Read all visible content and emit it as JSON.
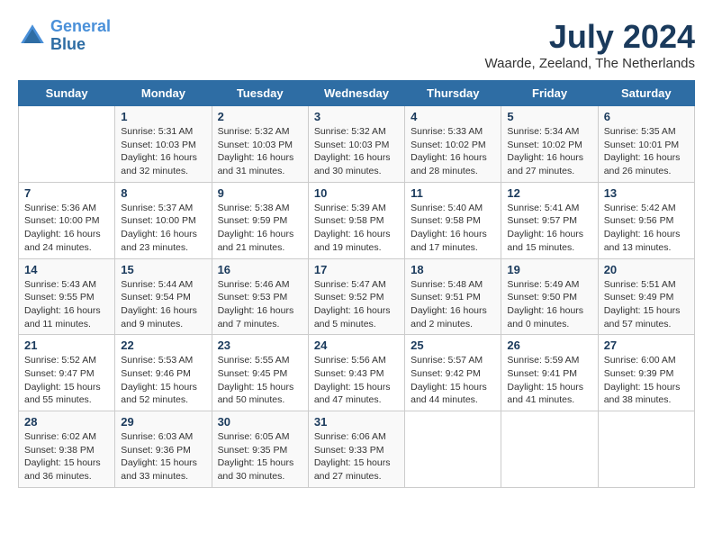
{
  "header": {
    "logo_line1": "General",
    "logo_line2": "Blue",
    "month_year": "July 2024",
    "location": "Waarde, Zeeland, The Netherlands"
  },
  "days_of_week": [
    "Sunday",
    "Monday",
    "Tuesday",
    "Wednesday",
    "Thursday",
    "Friday",
    "Saturday"
  ],
  "weeks": [
    [
      {
        "day": "",
        "info": ""
      },
      {
        "day": "1",
        "info": "Sunrise: 5:31 AM\nSunset: 10:03 PM\nDaylight: 16 hours\nand 32 minutes."
      },
      {
        "day": "2",
        "info": "Sunrise: 5:32 AM\nSunset: 10:03 PM\nDaylight: 16 hours\nand 31 minutes."
      },
      {
        "day": "3",
        "info": "Sunrise: 5:32 AM\nSunset: 10:03 PM\nDaylight: 16 hours\nand 30 minutes."
      },
      {
        "day": "4",
        "info": "Sunrise: 5:33 AM\nSunset: 10:02 PM\nDaylight: 16 hours\nand 28 minutes."
      },
      {
        "day": "5",
        "info": "Sunrise: 5:34 AM\nSunset: 10:02 PM\nDaylight: 16 hours\nand 27 minutes."
      },
      {
        "day": "6",
        "info": "Sunrise: 5:35 AM\nSunset: 10:01 PM\nDaylight: 16 hours\nand 26 minutes."
      }
    ],
    [
      {
        "day": "7",
        "info": "Sunrise: 5:36 AM\nSunset: 10:00 PM\nDaylight: 16 hours\nand 24 minutes."
      },
      {
        "day": "8",
        "info": "Sunrise: 5:37 AM\nSunset: 10:00 PM\nDaylight: 16 hours\nand 23 minutes."
      },
      {
        "day": "9",
        "info": "Sunrise: 5:38 AM\nSunset: 9:59 PM\nDaylight: 16 hours\nand 21 minutes."
      },
      {
        "day": "10",
        "info": "Sunrise: 5:39 AM\nSunset: 9:58 PM\nDaylight: 16 hours\nand 19 minutes."
      },
      {
        "day": "11",
        "info": "Sunrise: 5:40 AM\nSunset: 9:58 PM\nDaylight: 16 hours\nand 17 minutes."
      },
      {
        "day": "12",
        "info": "Sunrise: 5:41 AM\nSunset: 9:57 PM\nDaylight: 16 hours\nand 15 minutes."
      },
      {
        "day": "13",
        "info": "Sunrise: 5:42 AM\nSunset: 9:56 PM\nDaylight: 16 hours\nand 13 minutes."
      }
    ],
    [
      {
        "day": "14",
        "info": "Sunrise: 5:43 AM\nSunset: 9:55 PM\nDaylight: 16 hours\nand 11 minutes."
      },
      {
        "day": "15",
        "info": "Sunrise: 5:44 AM\nSunset: 9:54 PM\nDaylight: 16 hours\nand 9 minutes."
      },
      {
        "day": "16",
        "info": "Sunrise: 5:46 AM\nSunset: 9:53 PM\nDaylight: 16 hours\nand 7 minutes."
      },
      {
        "day": "17",
        "info": "Sunrise: 5:47 AM\nSunset: 9:52 PM\nDaylight: 16 hours\nand 5 minutes."
      },
      {
        "day": "18",
        "info": "Sunrise: 5:48 AM\nSunset: 9:51 PM\nDaylight: 16 hours\nand 2 minutes."
      },
      {
        "day": "19",
        "info": "Sunrise: 5:49 AM\nSunset: 9:50 PM\nDaylight: 16 hours\nand 0 minutes."
      },
      {
        "day": "20",
        "info": "Sunrise: 5:51 AM\nSunset: 9:49 PM\nDaylight: 15 hours\nand 57 minutes."
      }
    ],
    [
      {
        "day": "21",
        "info": "Sunrise: 5:52 AM\nSunset: 9:47 PM\nDaylight: 15 hours\nand 55 minutes."
      },
      {
        "day": "22",
        "info": "Sunrise: 5:53 AM\nSunset: 9:46 PM\nDaylight: 15 hours\nand 52 minutes."
      },
      {
        "day": "23",
        "info": "Sunrise: 5:55 AM\nSunset: 9:45 PM\nDaylight: 15 hours\nand 50 minutes."
      },
      {
        "day": "24",
        "info": "Sunrise: 5:56 AM\nSunset: 9:43 PM\nDaylight: 15 hours\nand 47 minutes."
      },
      {
        "day": "25",
        "info": "Sunrise: 5:57 AM\nSunset: 9:42 PM\nDaylight: 15 hours\nand 44 minutes."
      },
      {
        "day": "26",
        "info": "Sunrise: 5:59 AM\nSunset: 9:41 PM\nDaylight: 15 hours\nand 41 minutes."
      },
      {
        "day": "27",
        "info": "Sunrise: 6:00 AM\nSunset: 9:39 PM\nDaylight: 15 hours\nand 38 minutes."
      }
    ],
    [
      {
        "day": "28",
        "info": "Sunrise: 6:02 AM\nSunset: 9:38 PM\nDaylight: 15 hours\nand 36 minutes."
      },
      {
        "day": "29",
        "info": "Sunrise: 6:03 AM\nSunset: 9:36 PM\nDaylight: 15 hours\nand 33 minutes."
      },
      {
        "day": "30",
        "info": "Sunrise: 6:05 AM\nSunset: 9:35 PM\nDaylight: 15 hours\nand 30 minutes."
      },
      {
        "day": "31",
        "info": "Sunrise: 6:06 AM\nSunset: 9:33 PM\nDaylight: 15 hours\nand 27 minutes."
      },
      {
        "day": "",
        "info": ""
      },
      {
        "day": "",
        "info": ""
      },
      {
        "day": "",
        "info": ""
      }
    ]
  ]
}
